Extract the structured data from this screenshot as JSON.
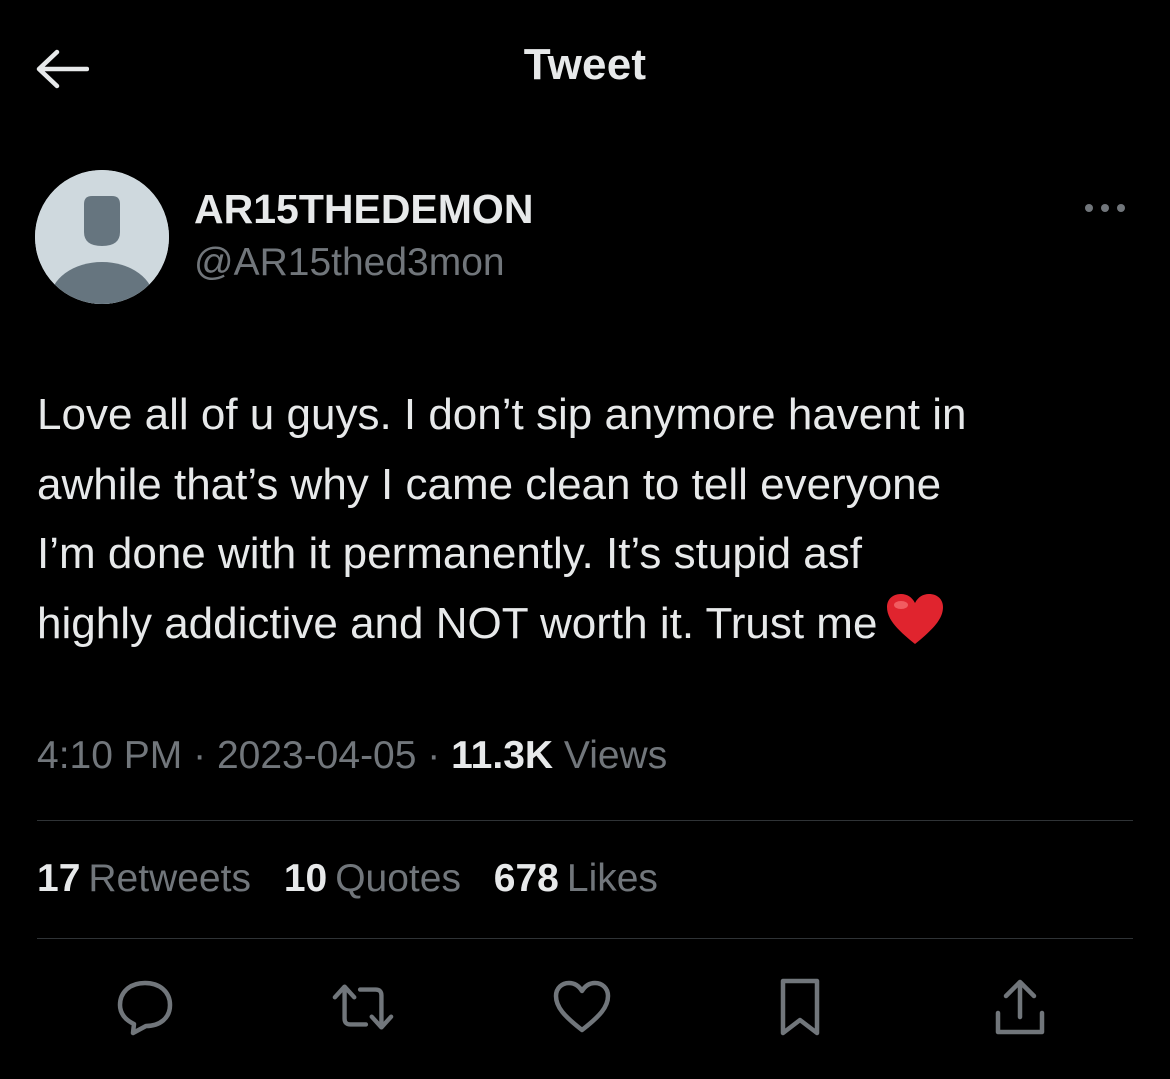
{
  "header": {
    "title": "Tweet",
    "back_icon": "arrow-left-icon"
  },
  "author": {
    "display_name": "AR15THEDEMON",
    "handle": "@AR15thed3mon",
    "avatar": "default-avatar-icon"
  },
  "more_icon": "more-horizontal-icon",
  "tweet": {
    "lines": [
      "Love all of u guys. I don’t sip anymore havent in",
      "awhile that’s why I came clean to tell everyone",
      "I’m done with it permanently. It’s stupid asf",
      "highly addictive and NOT worth it. Trust me"
    ],
    "emoji": "❤️"
  },
  "meta": {
    "time": "4:10 PM",
    "separator": "·",
    "date": "2023-04-05",
    "views_count": "11.3K",
    "views_label": "Views"
  },
  "stats": {
    "retweets_count": "17",
    "retweets_label": "Retweets",
    "quotes_count": "10",
    "quotes_label": "Quotes",
    "likes_count": "678",
    "likes_label": "Likes"
  },
  "actions": [
    {
      "name": "reply-icon"
    },
    {
      "name": "retweet-icon"
    },
    {
      "name": "like-icon"
    },
    {
      "name": "bookmark-icon"
    },
    {
      "name": "share-icon"
    }
  ],
  "colors": {
    "background": "#000000",
    "primary_text": "#e7e9ea",
    "secondary_text": "#71767b",
    "divider": "#2f3336",
    "heart": "#e0242e"
  }
}
